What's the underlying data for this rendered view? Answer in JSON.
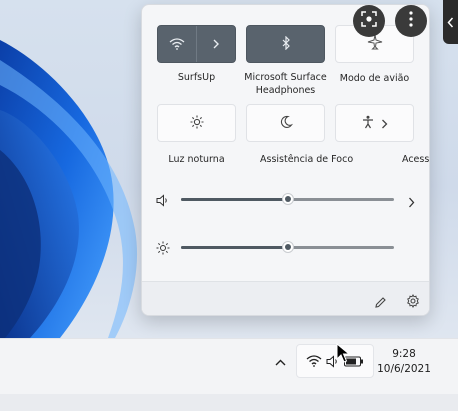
{
  "quick_settings": {
    "tiles": [
      {
        "label": "SurfsUp",
        "icon": "wifi-icon",
        "active": true
      },
      {
        "label": "Microsoft Surface Headphones",
        "icon": "bluetooth-icon",
        "active": true
      },
      {
        "label": "Modo de avião",
        "icon": "airplane-icon",
        "active": false
      },
      {
        "label": "Luz noturna",
        "icon": "brightness-sun-icon",
        "active": false
      },
      {
        "label": "Assistência de Foco",
        "icon": "moon-icon",
        "active": false
      },
      {
        "label": "Acessibilidade",
        "icon": "accessibility-icon",
        "active": false
      }
    ],
    "volume": {
      "level": 0.5,
      "icon": "speaker-icon"
    },
    "brightness": {
      "level": 0.5,
      "icon": "sun-icon"
    },
    "footer": {
      "edit_icon": "pencil-icon",
      "settings_icon": "gear-icon"
    }
  },
  "taskbar": {
    "time": "9:28",
    "date": "10/6/2021"
  },
  "overlay": {
    "icons": [
      "lens-scan-icon",
      "more-vertical-icon",
      "chevron-left-icon"
    ]
  },
  "colors": {
    "active_tile": "#59636d",
    "slider_fill": "#4f5962",
    "taskbar": "#f3f4f6"
  }
}
